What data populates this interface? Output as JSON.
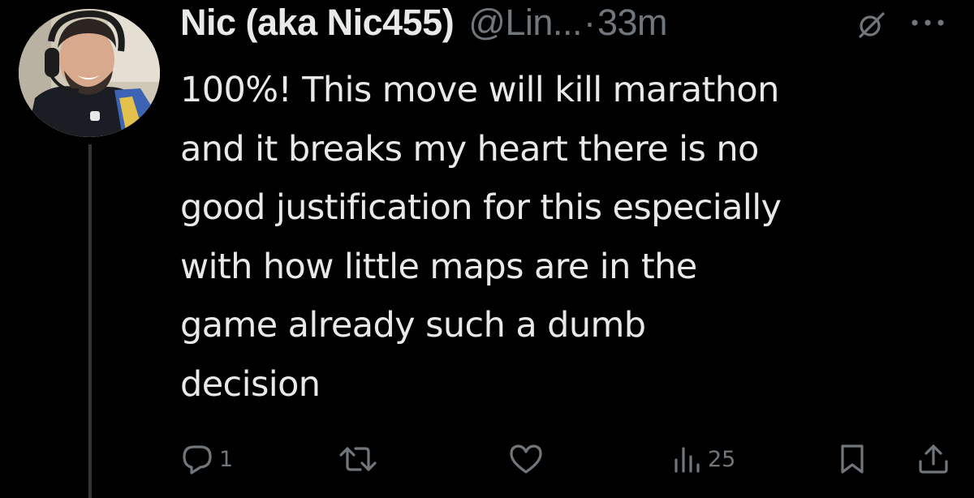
{
  "tweet": {
    "author": {
      "display_name": "Nic (aka Nic455)",
      "handle": "@Lin...",
      "avatar_icon": "avatar-photo"
    },
    "separator": "·",
    "time": "33m",
    "text_lines": [
      "100%! This move will kill marathon",
      "and it breaks my heart there is no",
      "good justification for this especially",
      "with how little maps are in the",
      "game already such a dumb",
      "decision"
    ],
    "actions": {
      "reply_count": "1",
      "repost_count": "",
      "like_count": "",
      "views_count": "25"
    },
    "icons": {
      "grok": "grok-icon",
      "more": "more-icon",
      "reply": "reply-icon",
      "repost": "repost-icon",
      "like": "heart-icon",
      "views": "views-chart-icon",
      "bookmark": "bookmark-icon",
      "share": "share-icon"
    },
    "colors": {
      "background": "#000000",
      "primary_text": "#e7e9ea",
      "secondary_text": "#71767b",
      "thread_line": "#333639"
    }
  }
}
